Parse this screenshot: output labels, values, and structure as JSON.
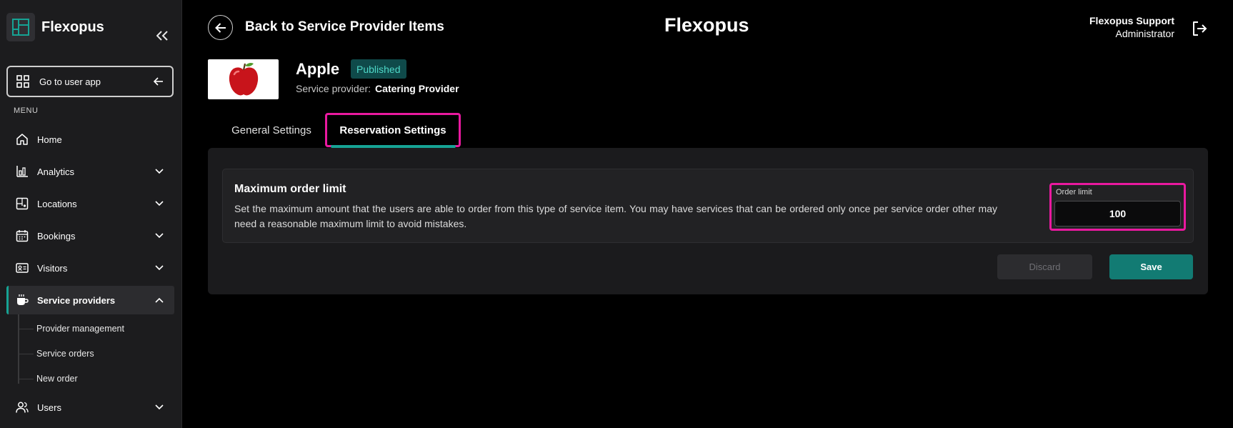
{
  "brand": {
    "name": "Flexopus",
    "logo_icon": "flexopus-logo-icon"
  },
  "sidebar": {
    "user_app_label": "Go to user app",
    "menu_label": "MENU",
    "items": [
      {
        "label": "Home",
        "icon": "home-icon"
      },
      {
        "label": "Analytics",
        "icon": "analytics-icon"
      },
      {
        "label": "Locations",
        "icon": "locations-icon"
      },
      {
        "label": "Bookings",
        "icon": "calendar-icon"
      },
      {
        "label": "Visitors",
        "icon": "visitor-card-icon"
      },
      {
        "label": "Service providers",
        "icon": "coffee-cup-icon"
      },
      {
        "label": "Users",
        "icon": "users-icon"
      }
    ],
    "sub_items": [
      {
        "label": "Provider management"
      },
      {
        "label": "Service orders"
      },
      {
        "label": "New order"
      }
    ]
  },
  "header": {
    "back_label": "Back to Service Provider Items",
    "title": "Flexopus",
    "user_name": "Flexopus Support",
    "user_role": "Administrator"
  },
  "item": {
    "name": "Apple",
    "status": "Published",
    "provider_key": "Service provider:",
    "provider_value": "Catering Provider"
  },
  "tabs": [
    {
      "label": "General Settings"
    },
    {
      "label": "Reservation Settings"
    }
  ],
  "setting": {
    "title": "Maximum order limit",
    "description": "Set the maximum amount that the users are able to order from this type of service item. You may have services that can be ordered only once per service order other may need a reasonable maximum limit to avoid mistakes.",
    "field_label": "Order limit",
    "field_value": "100"
  },
  "actions": {
    "discard": "Discard",
    "save": "Save"
  },
  "colors": {
    "accent": "#16a394",
    "highlight": "#e9199f",
    "badge_bg": "#0f4a4a",
    "badge_text": "#4ed8c8",
    "save_bg": "#127b73"
  }
}
